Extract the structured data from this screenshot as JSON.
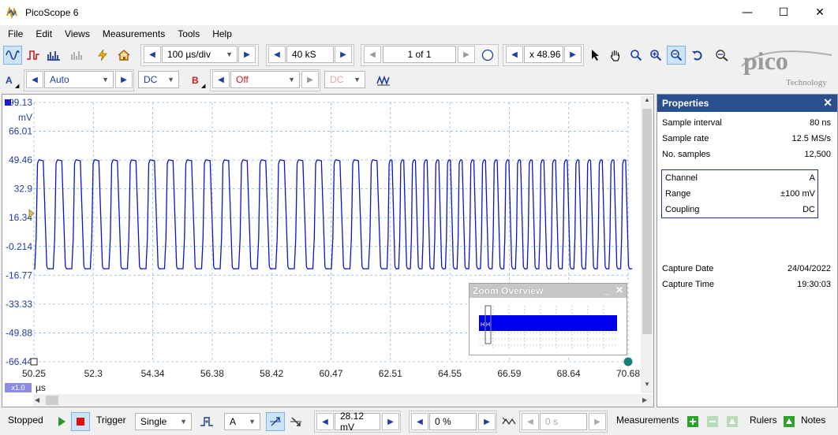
{
  "window": {
    "title": "PicoScope 6",
    "minimize": "—",
    "maximize": "☐",
    "close": "✕"
  },
  "menu": [
    "File",
    "Edit",
    "Views",
    "Measurements",
    "Tools",
    "Help"
  ],
  "toolbar1": {
    "timebase": "100 µs/div",
    "samples": "40 kS",
    "buffer": "1 of 1",
    "zoom": "x 48.96"
  },
  "toolbar2": {
    "channel_a_label": "A",
    "channel_a_range": "Auto",
    "channel_a_coupling": "DC",
    "channel_b_label": "B",
    "channel_b_range": "Off",
    "channel_b_coupling": "DC"
  },
  "logo": {
    "text": "pico",
    "sub": "Technology"
  },
  "scope": {
    "y_unit": "mV",
    "y_ticks": [
      "99.13",
      "66.01",
      "49.46",
      "32.9",
      "16.34",
      "-0.214",
      "-16.77",
      "-33.33",
      "-49.88",
      "-66.44"
    ],
    "x_ticks": [
      "50.25",
      "52.3",
      "54.34",
      "56.38",
      "58.42",
      "60.47",
      "62.51",
      "64.55",
      "66.59",
      "68.64",
      "70.68"
    ],
    "x_unit": "µs",
    "x_zoom_badge": "x1.0",
    "trace_color": "#0a14c8"
  },
  "zoom_overview": {
    "title": "Zoom Overview",
    "min": "_",
    "close": "✕"
  },
  "properties": {
    "title": "Properties",
    "close": "✕",
    "rows": [
      {
        "label": "Sample interval",
        "value": "80 ns"
      },
      {
        "label": "Sample rate",
        "value": "12.5 MS/s"
      },
      {
        "label": "No. samples",
        "value": "12,500"
      }
    ],
    "channel_rows": [
      {
        "label": "Channel",
        "value": "A"
      },
      {
        "label": "Range",
        "value": "±100 mV"
      },
      {
        "label": "Coupling",
        "value": "DC"
      }
    ],
    "capture_rows": [
      {
        "label": "Capture Date",
        "value": "24/04/2022"
      },
      {
        "label": "Capture Time",
        "value": "19:30:03"
      }
    ]
  },
  "statusbar": {
    "state": "Stopped",
    "trigger_label": "Trigger",
    "trigger_mode": "Single",
    "trigger_channel": "A",
    "trigger_level": "28.12 mV",
    "pre_trigger": "0 %",
    "delay": "0 s",
    "measurements": "Measurements",
    "rulers": "Rulers",
    "notes": "Notes"
  }
}
